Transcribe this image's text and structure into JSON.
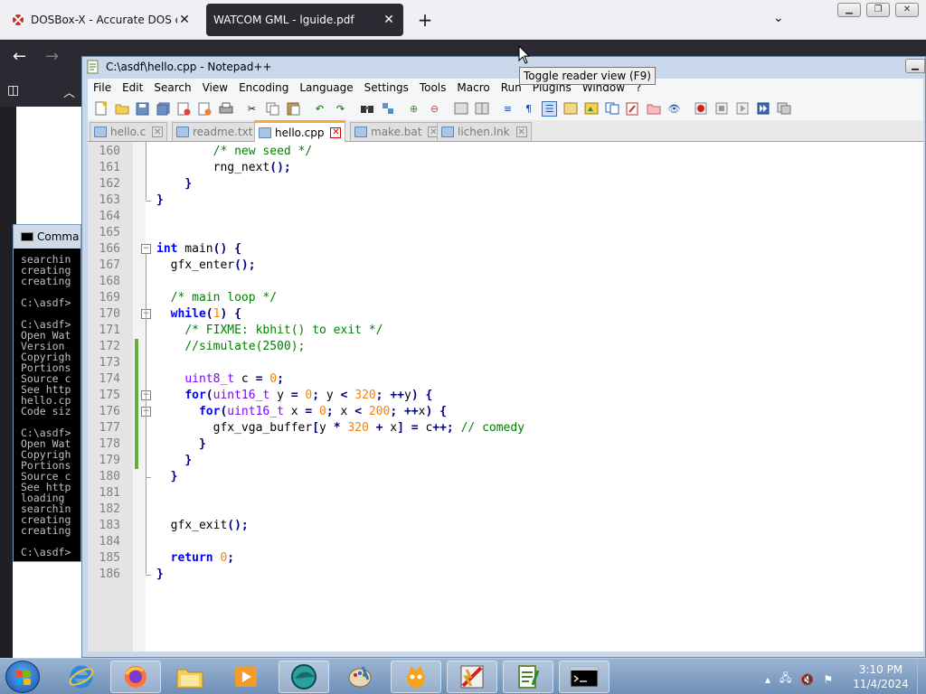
{
  "browser": {
    "tabs": [
      {
        "title": "DOSBox-X - Accurate DOS emu",
        "active": false
      },
      {
        "title": "WATCOM GML - lguide.pdf",
        "active": true
      }
    ],
    "tooltip": "Toggle reader view (F9)"
  },
  "cmd": {
    "title": "Comma",
    "lines": [
      "searchin",
      "creating",
      "creating",
      "",
      "C:\\asdf>",
      "",
      "C:\\asdf>",
      "Open Wat",
      "Version ",
      "Copyrigh",
      "Portions",
      "Source c",
      "See http",
      "hello.cp",
      "Code siz",
      "",
      "C:\\asdf>",
      "Open Wat",
      "Copyrigh",
      "Portions",
      "Source c",
      "See http",
      "loading ",
      "searchin",
      "creating",
      "creating",
      "",
      "C:\\asdf>"
    ]
  },
  "notepad": {
    "title": "C:\\asdf\\hello.cpp - Notepad++",
    "menu": [
      "File",
      "Edit",
      "Search",
      "View",
      "Encoding",
      "Language",
      "Settings",
      "Tools",
      "Macro",
      "Run",
      "Plugins",
      "Window",
      "?"
    ],
    "tabs": [
      {
        "label": "hello.c",
        "active": false
      },
      {
        "label": "readme.txt",
        "active": false
      },
      {
        "label": "hello.cpp",
        "active": true
      },
      {
        "label": "make.bat",
        "active": false
      },
      {
        "label": "lichen.lnk",
        "active": false
      }
    ],
    "lines": [
      {
        "n": "160",
        "tokens": [
          [
            "",
            "        "
          ],
          [
            "cm",
            "/* new seed */"
          ]
        ]
      },
      {
        "n": "161",
        "tokens": [
          [
            "",
            "        "
          ],
          [
            "id",
            "rng_next"
          ],
          [
            "op",
            "();"
          ]
        ]
      },
      {
        "n": "162",
        "tokens": [
          [
            "",
            "    "
          ],
          [
            "op",
            "}"
          ]
        ]
      },
      {
        "n": "163",
        "tokens": [
          [
            "op",
            "}"
          ]
        ]
      },
      {
        "n": "164",
        "tokens": []
      },
      {
        "n": "165",
        "tokens": []
      },
      {
        "n": "166",
        "tokens": [
          [
            "kw",
            "int"
          ],
          [
            "id",
            " main"
          ],
          [
            "op",
            "()"
          ],
          [
            "id",
            " "
          ],
          [
            "op",
            "{"
          ]
        ]
      },
      {
        "n": "167",
        "tokens": [
          [
            "",
            "  "
          ],
          [
            "id",
            "gfx_enter"
          ],
          [
            "op",
            "();"
          ]
        ]
      },
      {
        "n": "168",
        "tokens": []
      },
      {
        "n": "169",
        "tokens": [
          [
            "",
            "  "
          ],
          [
            "cm",
            "/* main loop */"
          ]
        ]
      },
      {
        "n": "170",
        "tokens": [
          [
            "",
            "  "
          ],
          [
            "kw",
            "while"
          ],
          [
            "op",
            "("
          ],
          [
            "nm",
            "1"
          ],
          [
            "op",
            ")"
          ],
          [
            "id",
            " "
          ],
          [
            "op",
            "{"
          ]
        ]
      },
      {
        "n": "171",
        "tokens": [
          [
            "",
            "    "
          ],
          [
            "cm",
            "/* FIXME: kbhit() to exit */"
          ]
        ]
      },
      {
        "n": "172",
        "tokens": [
          [
            "",
            "    "
          ],
          [
            "cm",
            "//simulate(2500);"
          ]
        ]
      },
      {
        "n": "173",
        "tokens": []
      },
      {
        "n": "174",
        "tokens": [
          [
            "",
            "    "
          ],
          [
            "ty",
            "uint8_t"
          ],
          [
            "id",
            " c "
          ],
          [
            "op",
            "="
          ],
          [
            "id",
            " "
          ],
          [
            "nm",
            "0"
          ],
          [
            "op",
            ";"
          ]
        ]
      },
      {
        "n": "175",
        "tokens": [
          [
            "",
            "    "
          ],
          [
            "kw",
            "for"
          ],
          [
            "op",
            "("
          ],
          [
            "ty",
            "uint16_t"
          ],
          [
            "id",
            " y "
          ],
          [
            "op",
            "="
          ],
          [
            "id",
            " "
          ],
          [
            "nm",
            "0"
          ],
          [
            "op",
            ";"
          ],
          [
            "id",
            " y "
          ],
          [
            "op",
            "<"
          ],
          [
            "id",
            " "
          ],
          [
            "nm",
            "320"
          ],
          [
            "op",
            ";"
          ],
          [
            "id",
            " "
          ],
          [
            "op",
            "++"
          ],
          [
            "id",
            "y"
          ],
          [
            "op",
            ")"
          ],
          [
            "id",
            " "
          ],
          [
            "op",
            "{"
          ]
        ]
      },
      {
        "n": "176",
        "tokens": [
          [
            "",
            "      "
          ],
          [
            "kw",
            "for"
          ],
          [
            "op",
            "("
          ],
          [
            "ty",
            "uint16_t"
          ],
          [
            "id",
            " x "
          ],
          [
            "op",
            "="
          ],
          [
            "id",
            " "
          ],
          [
            "nm",
            "0"
          ],
          [
            "op",
            ";"
          ],
          [
            "id",
            " x "
          ],
          [
            "op",
            "<"
          ],
          [
            "id",
            " "
          ],
          [
            "nm",
            "200"
          ],
          [
            "op",
            ";"
          ],
          [
            "id",
            " "
          ],
          [
            "op",
            "++"
          ],
          [
            "id",
            "x"
          ],
          [
            "op",
            ")"
          ],
          [
            "id",
            " "
          ],
          [
            "op",
            "{"
          ]
        ]
      },
      {
        "n": "177",
        "tokens": [
          [
            "",
            "        "
          ],
          [
            "id",
            "gfx_vga_buffer"
          ],
          [
            "op",
            "["
          ],
          [
            "id",
            "y "
          ],
          [
            "op",
            "*"
          ],
          [
            "id",
            " "
          ],
          [
            "nm",
            "320"
          ],
          [
            "id",
            " "
          ],
          [
            "op",
            "+"
          ],
          [
            "id",
            " x"
          ],
          [
            "op",
            "]"
          ],
          [
            "id",
            " "
          ],
          [
            "op",
            "="
          ],
          [
            "id",
            " c"
          ],
          [
            "op",
            "++;"
          ],
          [
            "id",
            " "
          ],
          [
            "cm",
            "// comedy"
          ]
        ]
      },
      {
        "n": "178",
        "tokens": [
          [
            "",
            "      "
          ],
          [
            "op",
            "}"
          ]
        ]
      },
      {
        "n": "179",
        "tokens": [
          [
            "",
            "    "
          ],
          [
            "op",
            "}"
          ]
        ]
      },
      {
        "n": "180",
        "tokens": [
          [
            "",
            "  "
          ],
          [
            "op",
            "}"
          ]
        ]
      },
      {
        "n": "181",
        "tokens": []
      },
      {
        "n": "182",
        "tokens": []
      },
      {
        "n": "183",
        "tokens": [
          [
            "",
            "  "
          ],
          [
            "id",
            "gfx_exit"
          ],
          [
            "op",
            "();"
          ]
        ]
      },
      {
        "n": "184",
        "tokens": []
      },
      {
        "n": "185",
        "tokens": [
          [
            "",
            "  "
          ],
          [
            "kw",
            "return"
          ],
          [
            "id",
            " "
          ],
          [
            "nm",
            "0"
          ],
          [
            "op",
            ";"
          ]
        ]
      },
      {
        "n": "186",
        "tokens": [
          [
            "op",
            "}"
          ]
        ]
      }
    ]
  },
  "taskbar": {
    "time": "3:10 PM",
    "date": "11/4/2024"
  },
  "colors": {
    "keyword": "#0000ff",
    "type": "#8000ff",
    "number": "#ff8000",
    "comment": "#008000",
    "operator": "#000080",
    "change_marker": "#62b03a",
    "active_tab_accent": "#fba832"
  }
}
